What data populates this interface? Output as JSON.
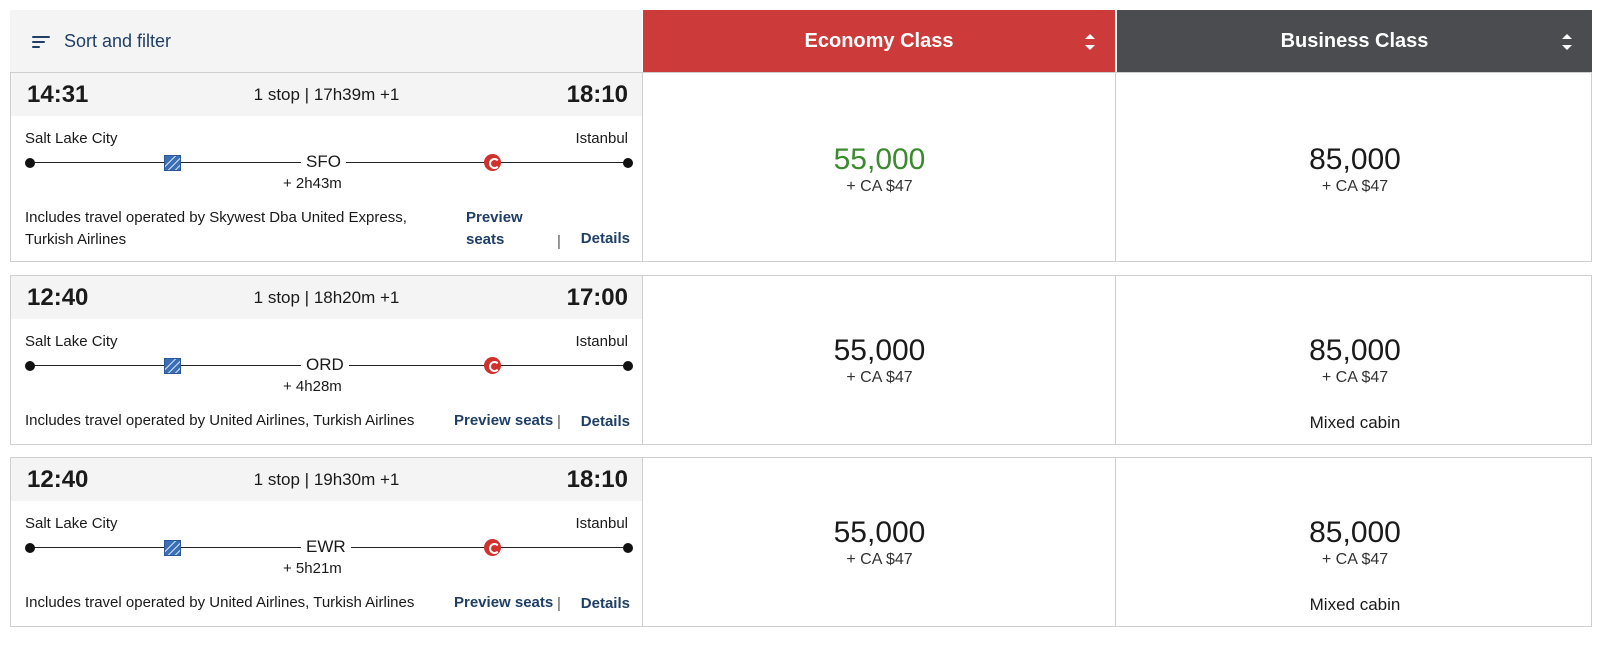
{
  "header": {
    "sort_label": "Sort and filter",
    "economy_label": "Economy Class",
    "business_label": "Business Class",
    "economy_color": "#cc3b3a",
    "business_color": "#4a4c50"
  },
  "flights": [
    {
      "depart": "14:31",
      "summary": "1 stop | 17h39m +1",
      "arrive": "18:10",
      "origin": "Salt Lake City",
      "destination": "Istanbul",
      "connection": "SFO",
      "layover": "+ 2h43m",
      "operated_by": "Includes travel operated by Skywest Dba United Express, Turkish Airlines",
      "operated_line1": "Includes travel operated by Skywest Dba United Express,",
      "operated_line2": "Turkish Airlines",
      "preview": "Preview seats",
      "preview_line1": "Preview",
      "preview_line2": "seats",
      "details": "Details",
      "economy": {
        "miles": "55,000",
        "tax": "+ CA $47",
        "highlight": true
      },
      "business": {
        "miles": "85,000",
        "tax": "+ CA $47",
        "note": ""
      }
    },
    {
      "depart": "12:40",
      "summary": "1 stop | 18h20m +1",
      "arrive": "17:00",
      "origin": "Salt Lake City",
      "destination": "Istanbul",
      "connection": "ORD",
      "layover": "+ 4h28m",
      "operated_by": "Includes travel operated by United Airlines, Turkish Airlines",
      "preview": "Preview seats",
      "details": "Details",
      "economy": {
        "miles": "55,000",
        "tax": "+ CA $47",
        "highlight": false
      },
      "business": {
        "miles": "85,000",
        "tax": "+ CA $47",
        "note": "Mixed cabin"
      }
    },
    {
      "depart": "12:40",
      "summary": "1 stop | 19h30m +1",
      "arrive": "18:10",
      "origin": "Salt Lake City",
      "destination": "Istanbul",
      "connection": "EWR",
      "layover": "+ 5h21m",
      "operated_by": "Includes travel operated by United Airlines, Turkish Airlines",
      "preview": "Preview seats",
      "details": "Details",
      "economy": {
        "miles": "55,000",
        "tax": "+ CA $47",
        "highlight": false
      },
      "business": {
        "miles": "85,000",
        "tax": "+ CA $47",
        "note": "Mixed cabin"
      }
    }
  ],
  "icons": {
    "sort": "sort-filter-icon",
    "carrier1": "united-airlines-logo-icon",
    "carrier2": "turkish-airlines-logo-icon"
  },
  "colors": {
    "link": "#1f3f66",
    "highlight_price": "#3a8a2e"
  }
}
